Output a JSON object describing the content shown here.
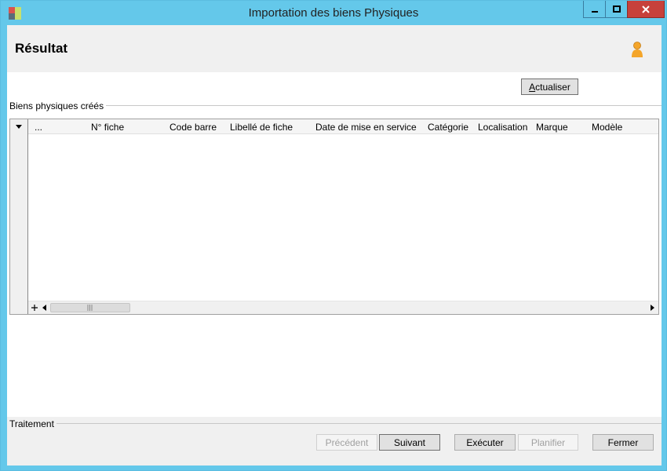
{
  "window": {
    "title": "Importation des biens Physiques"
  },
  "icons": {
    "app": "app-icon",
    "minimize": "minimize-icon",
    "maximize": "maximize-icon",
    "close": "close-icon",
    "user": "user-icon",
    "dropdown": "dropdown-arrow-icon",
    "expand": "plus-icon",
    "scroll_left": "scroll-left-icon",
    "scroll_right": "scroll-right-icon"
  },
  "header": {
    "title": "Résultat"
  },
  "toolbar": {
    "refresh_label_accel": "A",
    "refresh_label_rest": "ctualiser"
  },
  "group_created": {
    "label": "Biens physiques créés",
    "columns": [
      "...",
      "N° fiche",
      "Code barre",
      "Libellé de fiche",
      "Date de mise en service",
      "Catégorie",
      "Localisation",
      "Marque",
      "Modèle"
    ],
    "rows": []
  },
  "group_treatment": {
    "label": "Traitement"
  },
  "footer": {
    "previous_label": "Précédent",
    "next_label": "Suivant",
    "execute_label": "Exécuter",
    "schedule_label": "Planifier",
    "close_label": "Fermer"
  },
  "colors": {
    "titlebar": "#64c8ea",
    "close_button": "#c7413b",
    "panel_gray": "#f0f0f0"
  }
}
